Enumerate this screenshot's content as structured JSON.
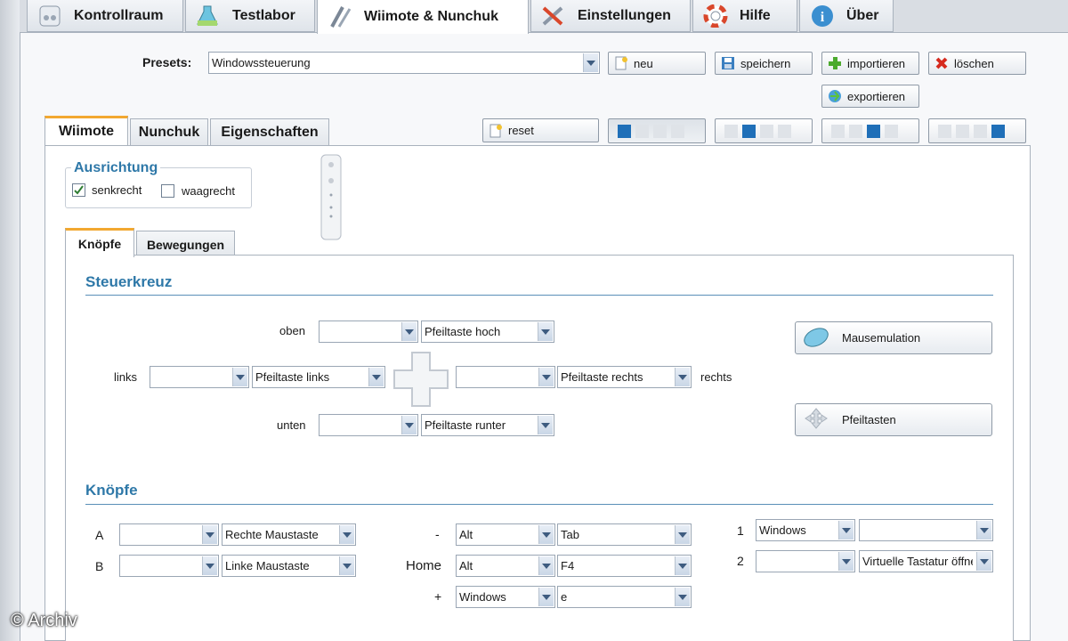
{
  "top_tabs": [
    {
      "label": "Kontrollraum",
      "icon": "controller-icon"
    },
    {
      "label": "Testlabor",
      "icon": "lab-icon"
    },
    {
      "label": "Wiimote & Nunchuk",
      "icon": "wiimote-icon",
      "active": true
    },
    {
      "label": "Einstellungen",
      "icon": "tools-icon"
    },
    {
      "label": "Hilfe",
      "icon": "lifebuoy-icon"
    },
    {
      "label": "Über",
      "icon": "info-icon"
    }
  ],
  "presets": {
    "label": "Presets:",
    "selected": "Windowssteuerung",
    "buttons": {
      "new": "neu",
      "save": "speichern",
      "import": "importieren",
      "delete": "löschen",
      "export": "exportieren"
    }
  },
  "device_tabs": [
    "Wiimote",
    "Nunchuk",
    "Eigenschaften"
  ],
  "reset_label": "reset",
  "led_sets": [
    [
      1,
      0,
      0,
      0
    ],
    [
      0,
      1,
      0,
      0
    ],
    [
      0,
      0,
      1,
      0
    ],
    [
      0,
      0,
      0,
      1
    ]
  ],
  "orientation": {
    "title": "Ausrichtung",
    "vertical": "senkrecht",
    "horizontal": "waagrecht",
    "vertical_checked": true
  },
  "sub_tabs": [
    "Knöpfe",
    "Bewegungen"
  ],
  "dpad": {
    "title": "Steuerkreuz",
    "up": {
      "label": "oben",
      "modifier": "",
      "key": "Pfeiltaste hoch"
    },
    "left": {
      "label": "links",
      "modifier": "",
      "key": "Pfeiltaste links"
    },
    "right": {
      "label": "rechts",
      "modifier": "",
      "key": "Pfeiltaste rechts"
    },
    "down": {
      "label": "unten",
      "modifier": "",
      "key": "Pfeiltaste runter"
    },
    "mouse_emulation": "Mausemulation",
    "arrow_keys": "Pfeiltasten"
  },
  "buttons": {
    "title": "Knöpfe",
    "a": {
      "label": "A",
      "modifier": "",
      "key": "Rechte Maustaste"
    },
    "b": {
      "label": "B",
      "modifier": "",
      "key": "Linke Maustaste"
    },
    "minus": {
      "label": "-",
      "modifier": "Alt",
      "key": "Tab"
    },
    "home": {
      "label": "Home",
      "modifier": "Alt",
      "key": "F4"
    },
    "plus": {
      "label": "+",
      "modifier": "Windows",
      "key": "e"
    },
    "one": {
      "label": "1",
      "modifier": "Windows",
      "key": ""
    },
    "two": {
      "label": "2",
      "modifier": "",
      "key": "Virtuelle Tastatur öffnen"
    }
  },
  "watermark": "© Archiv",
  "colors": {
    "accent": "#2e78a8",
    "tab_highlight": "#f2a830",
    "led_on": "#1f6fb8"
  }
}
